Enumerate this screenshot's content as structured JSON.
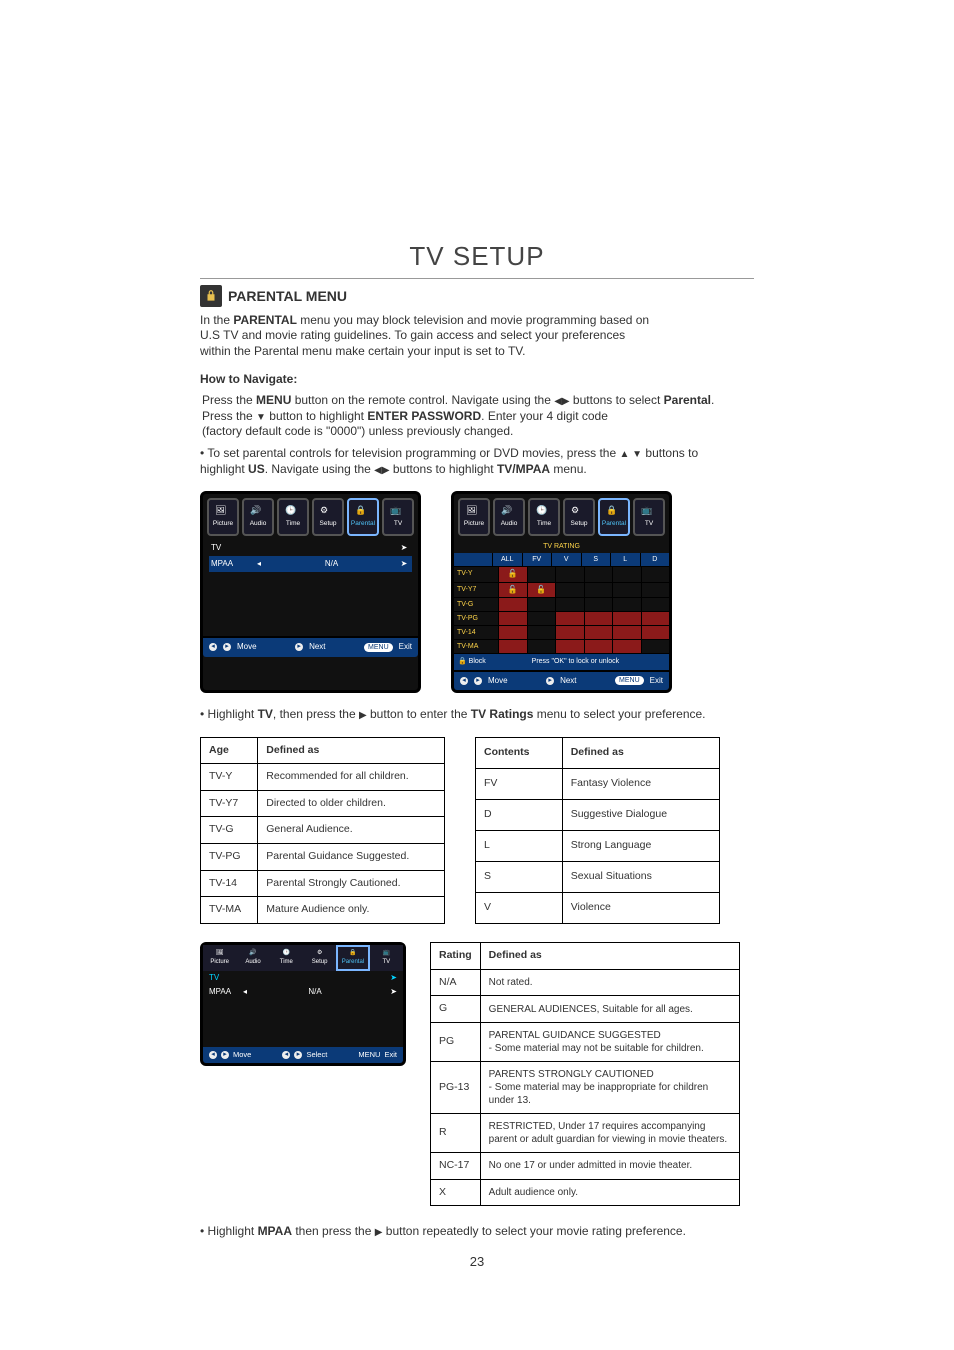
{
  "page_title": "TV SETUP",
  "page_number": "23",
  "section": {
    "title": "PARENTAL MENU"
  },
  "intro": {
    "l1a": "In the ",
    "l1b": "PARENTAL",
    "l1c": " menu you may block television and movie programming based on",
    "l2": "U.S TV and movie rating guidelines. To gain access and select your preferences",
    "l3": "within the Parental menu make certain your input is set to TV."
  },
  "howto": "How to Navigate:",
  "nav": {
    "p1": {
      "a": "Press the ",
      "b": "MENU",
      "c": " button on the remote control. Navigate using the ",
      "d": " buttons to select ",
      "e": "Parental",
      "f": "."
    },
    "p2": {
      "a": "Press the ",
      "b": " button to highlight ",
      "c": "ENTER PASSWORD",
      "d": ". Enter your 4 digit code"
    },
    "p3": "(factory default code is \"0000\") unless previously changed.",
    "p4": {
      "a": "• To set parental controls for television programming or DVD movies, press the ",
      "b": " buttons to",
      "c": "highlight ",
      "d": "US",
      "e": ". Navigate using the ",
      "f": " buttons to highlight ",
      "g": "TV/MPAA",
      "h": " menu."
    }
  },
  "osd_tabs": [
    "Picture",
    "Audio",
    "Time",
    "Setup",
    "Parental",
    "TV"
  ],
  "osd1": {
    "row1": {
      "label": "TV",
      "value": "",
      "right": "➤"
    },
    "row2": {
      "label": "MPAA",
      "left": "◂",
      "value": "N/A",
      "right": "➤"
    },
    "footer": {
      "move": "Move",
      "next": "Next",
      "pill": "MENU",
      "exit": "Exit"
    }
  },
  "osd_rating": {
    "header_top": "TV    RATING",
    "cols": [
      "ALL",
      "FV",
      "V",
      "S",
      "L",
      "D"
    ],
    "rows": [
      "TV-Y",
      "TV-Y7",
      "TV-G",
      "TV-PG",
      "TV-14",
      "TV-MA"
    ],
    "blockrow": {
      "a": "🔒  Block",
      "b": "Press \"OK\" to lock or unlock"
    },
    "footer": {
      "move": "Move",
      "next": "Next",
      "pill": "MENU",
      "exit": "Exit"
    }
  },
  "midline": {
    "a": "• Highlight ",
    "b": "TV",
    "c": ", then press the ",
    "d": " button to enter the ",
    "e": "TV Ratings",
    "f": " menu to select your preference."
  },
  "age_table": {
    "h1": "Age",
    "h2": "Defined as",
    "rows": [
      [
        "TV-Y",
        "Recommended for all children."
      ],
      [
        "TV-Y7",
        "Directed to older children."
      ],
      [
        "TV-G",
        "General Audience."
      ],
      [
        "TV-PG",
        "Parental Guidance Suggested."
      ],
      [
        "TV-14",
        "Parental Strongly Cautioned."
      ],
      [
        "TV-MA",
        "Mature Audience only."
      ]
    ]
  },
  "contents_table": {
    "h1": "Contents",
    "h2": "Defined as",
    "rows": [
      [
        "FV",
        "Fantasy Violence"
      ],
      [
        "D",
        "Suggestive Dialogue"
      ],
      [
        "L",
        "Strong Language"
      ],
      [
        "S",
        "Sexual Situations"
      ],
      [
        "V",
        "Violence"
      ]
    ]
  },
  "osd2": {
    "row1": {
      "label": "TV",
      "right": "➤"
    },
    "row2": {
      "label": "MPAA",
      "left": "◂",
      "value": "N/A",
      "right": "➤"
    },
    "footer": {
      "move": "Move",
      "mid": "Select",
      "pill": "MENU",
      "exit": "Exit"
    }
  },
  "mpaa_table": {
    "h1": "Rating",
    "h2": "Defined as",
    "rows": [
      [
        "N/A",
        "Not rated."
      ],
      [
        "G",
        "GENERAL AUDIENCES, Suitable for all ages."
      ],
      [
        "PG",
        "PARENTAL GUIDANCE SUGGESTED\n- Some material may not be suitable for children."
      ],
      [
        "PG-13",
        "PARENTS STRONGLY CAUTIONED\n- Some material may be inappropriate for children under 13."
      ],
      [
        "R",
        "RESTRICTED, Under 17 requires accompanying parent or adult guardian for viewing in movie theaters."
      ],
      [
        "NC-17",
        "No one 17 or under admitted in movie theater."
      ],
      [
        "X",
        "Adult audience only."
      ]
    ]
  },
  "lastline": {
    "a": "• Highlight ",
    "b": "MPAA",
    "c": " then press the ",
    "d": " button repeatedly to select your movie rating preference."
  }
}
